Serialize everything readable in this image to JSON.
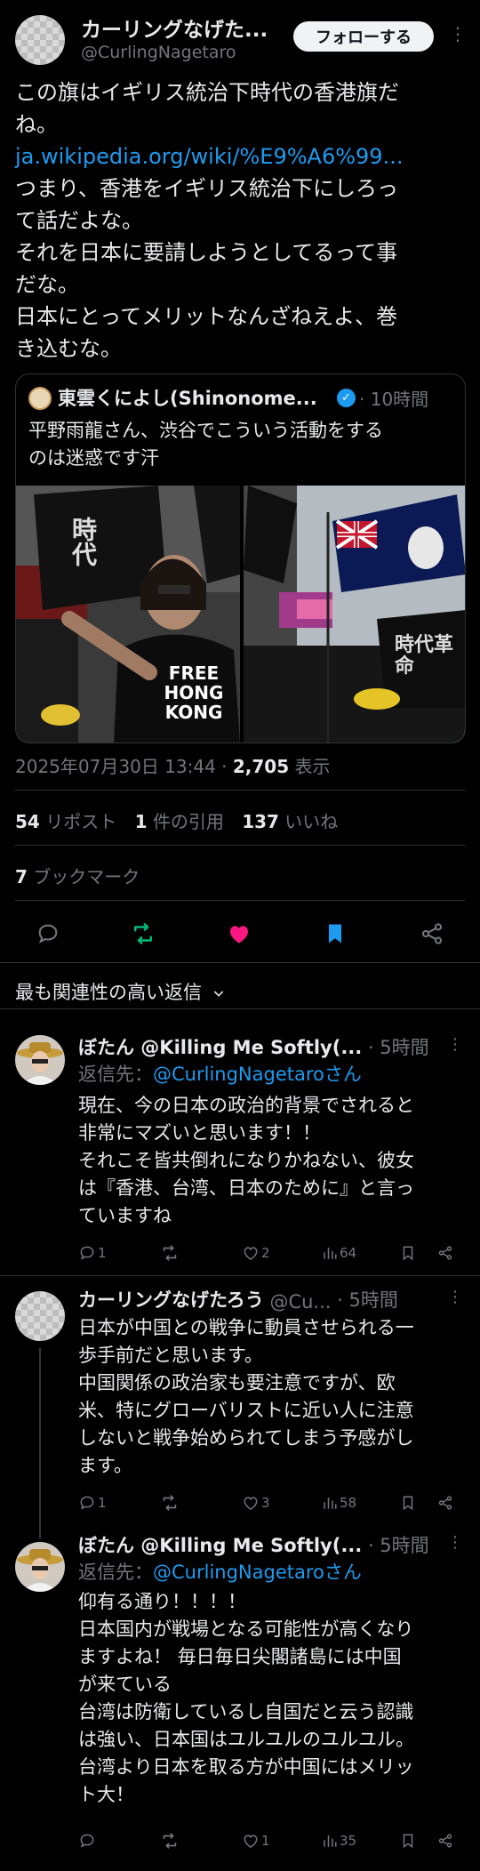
{
  "author": {
    "display_name": "カーリングなげた...",
    "handle": "@CurlingNagetaro",
    "follow_label": "フォローする",
    "more": "⋮"
  },
  "tweet": {
    "lines": [
      "この旗はイギリス統治下時代の香港旗だ",
      "ね。",
      "ja.wikipedia.org/wiki/%E9%A6%99...",
      "つまり、香港をイギリス統治下にしろっ",
      "て話だよな。",
      "それを日本に要請しようとしてるって事",
      "だな。",
      "日本にとってメリットなんざねえよ、巻",
      "き込むな。"
    ]
  },
  "quote": {
    "name": "東雲くによし(Shinonome...",
    "time": "· 10時間",
    "lines": [
      "平野雨龍さん、渋谷でこういう活動をする",
      "のは迷惑です汗"
    ],
    "image_left_text": "FREE HONG KONG",
    "image_left_sign": "時代",
    "image_right_sign": "時代革命"
  },
  "meta": {
    "timestamp": "2025年07月30日 13:44 · ",
    "views_count": "2,705",
    "views_label": " 表示"
  },
  "stats": {
    "reposts_count": "54",
    "reposts_label": " リポスト",
    "quotes_count": "1",
    "quotes_label": " 件の引用",
    "likes_count": "137",
    "likes_label": " いいね",
    "bookmarks_count": "7",
    "bookmarks_label": " ブックマーク"
  },
  "colors": {
    "repost": "#00ba7c",
    "like": "#f91880",
    "bookmark": "#1d9bf0",
    "link": "#1d9bf0"
  },
  "sort_label": "最も関連性の高い返信",
  "replies": [
    {
      "name": "ぼたん @Killing Me Softly(...",
      "handle": "",
      "time": "· 5時間",
      "reply_to_prefix": "返信先：",
      "reply_to": "@CurlingNagetaroさん",
      "lines": [
        "現在、今の日本の政治的背景でされると",
        "非常にマズいと思います！！",
        "それこそ皆共倒れになりかねない、彼女",
        "は『香港、台湾、日本のために』と言っ",
        "ていますね"
      ],
      "replies": "1",
      "retweets": "",
      "likes": "2",
      "views": "64"
    },
    {
      "name": "カーリングなげたろう",
      "handle": "@Cu...",
      "time": "· 5時間",
      "lines": [
        "日本が中国との戦争に動員させられる一",
        "歩手前だと思います。",
        "中国関係の政治家も要注意ですが、欧",
        "米、特にグローバリストに近い人に注意",
        "しないと戦争始められてしまう予感がし",
        "ます。"
      ],
      "replies": "1",
      "retweets": "",
      "likes": "3",
      "views": "58"
    },
    {
      "name": "ぼたん @Killing Me Softly(...",
      "handle": "",
      "time": "· 5時間",
      "reply_to_prefix": "返信先：",
      "reply_to": "@CurlingNagetaroさん",
      "lines": [
        "仰有る通り！！！！",
        "日本国内が戦場となる可能性が高くなり",
        "ますよね！ 毎日毎日尖閣諸島には中国",
        "が来ている",
        "台湾は防衛しているし自国だと云う認識",
        "は強い、日本国はユルユルのユルユル。",
        "台湾より日本を取る方が中国にはメリッ",
        "ト大！"
      ],
      "replies": "",
      "retweets": "",
      "likes": "1",
      "views": "35"
    }
  ]
}
